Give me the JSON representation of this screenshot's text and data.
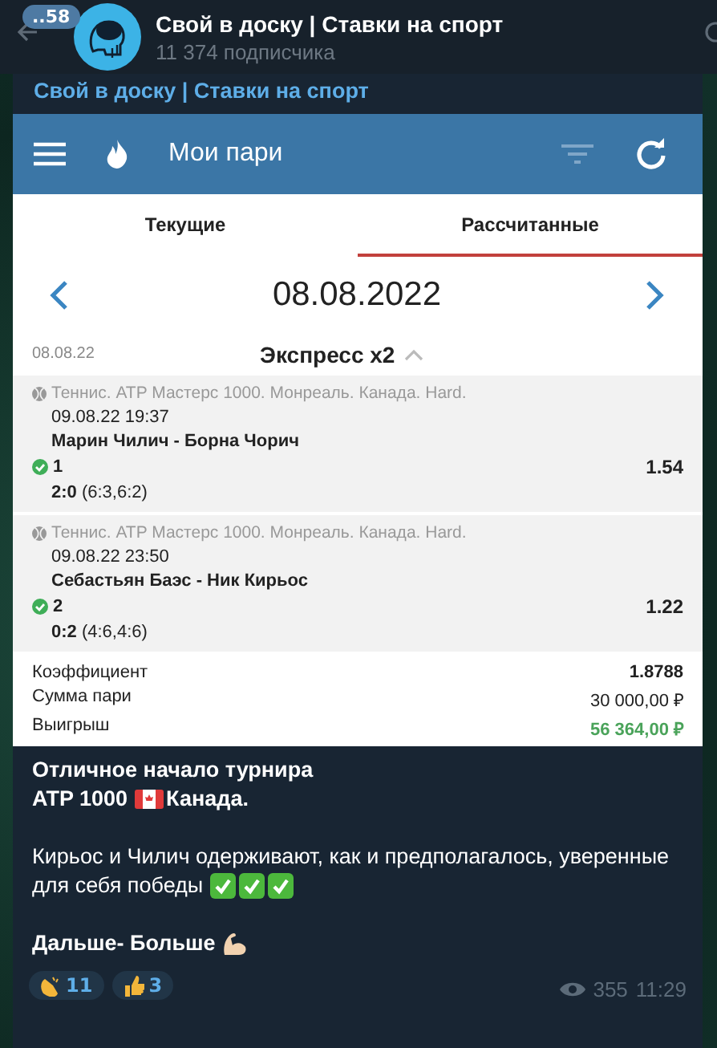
{
  "header": {
    "unread": "..58",
    "title": "Свой в доску | Ставки на спорт",
    "subtitle": "11 374 подписчика"
  },
  "post": {
    "author": "Свой в доску | Ставки на спорт",
    "app": {
      "title": "Мои пари",
      "tabs": [
        {
          "label": "Текущие",
          "selected": false
        },
        {
          "label": "Рассчитанные",
          "selected": true
        }
      ],
      "date": "08.08.2022",
      "bet": {
        "date": "08.08.22",
        "type": "Экспресс x2",
        "expanded": true
      },
      "events": [
        {
          "league": "Теннис. ATP Мастерс 1000. Монреаль. Канада. Hard.",
          "time": "09.08.22 19:37",
          "match": "Марин Чилич - Борна Чорич",
          "pick": "1",
          "won": true,
          "odds": "1.54",
          "score": "2:0",
          "sets": "(6:3,6:2)"
        },
        {
          "league": "Теннис. ATP Мастерс 1000. Монреаль. Канада. Hard.",
          "time": "09.08.22 23:50",
          "match": "Себастьян Баэс - Ник Кирьос",
          "pick": "2",
          "won": true,
          "odds": "1.22",
          "score": "0:2",
          "sets": "(4:6,4:6)"
        }
      ],
      "summary": [
        {
          "label": "Коэффициент",
          "value": "1.8788",
          "kind": "bold"
        },
        {
          "label": "Сумма пари",
          "value": "30 000,00 ₽",
          "kind": "plain"
        },
        {
          "label": "Выигрыш",
          "value": "56 364,00 ₽",
          "kind": "win"
        }
      ]
    },
    "message": [
      {
        "bold": true,
        "lines": [
          [
            {
              "kind": "text",
              "text": "Отличное начало турнира"
            }
          ],
          [
            {
              "kind": "text",
              "text": "ATP 1000"
            },
            {
              "kind": "flag"
            },
            {
              "kind": "text",
              "text": "Канада."
            }
          ]
        ]
      },
      {
        "bold": false,
        "lines": [
          [
            {
              "kind": "text",
              "text": "Кирьос и Чилич одерживают, как и предполагалось, уверенные"
            }
          ],
          [
            {
              "kind": "text",
              "text": "для себя победы"
            },
            {
              "kind": "check"
            },
            {
              "kind": "check"
            },
            {
              "kind": "check"
            }
          ]
        ]
      },
      {
        "bold": true,
        "lines": [
          [
            {
              "kind": "text",
              "text": "Дальше- Больше"
            },
            {
              "kind": "muscle"
            }
          ]
        ]
      }
    ],
    "reactions": [
      {
        "kind": "clap",
        "count": "11"
      },
      {
        "kind": "thumbs",
        "count": "3"
      }
    ],
    "views": "355",
    "time": "11:29"
  }
}
